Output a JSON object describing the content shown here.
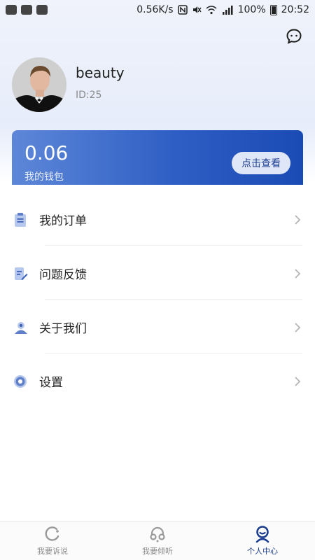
{
  "status_bar": {
    "network_speed": "0.56K/s",
    "battery": "100%",
    "time": "20:52"
  },
  "profile": {
    "name": "beauty",
    "id_text": "ID:25"
  },
  "wallet": {
    "amount": "0.06",
    "label": "我的钱包",
    "button": "点击查看"
  },
  "menu": {
    "items": [
      {
        "label": "我的订单",
        "icon": "clipboard-icon"
      },
      {
        "label": "问题反馈",
        "icon": "feedback-icon"
      },
      {
        "label": "关于我们",
        "icon": "about-icon"
      },
      {
        "label": "设置",
        "icon": "settings-icon"
      }
    ]
  },
  "bottom_nav": {
    "items": [
      {
        "label": "我要诉说",
        "icon": "talk-icon",
        "active": false
      },
      {
        "label": "我要倾听",
        "icon": "headphones-icon",
        "active": false
      },
      {
        "label": "个人中心",
        "icon": "profile-icon",
        "active": true
      }
    ]
  },
  "colors": {
    "accent": "#1c3e91",
    "wallet_gradient_start": "#5d87d8",
    "wallet_gradient_end": "#1a4ab4"
  }
}
